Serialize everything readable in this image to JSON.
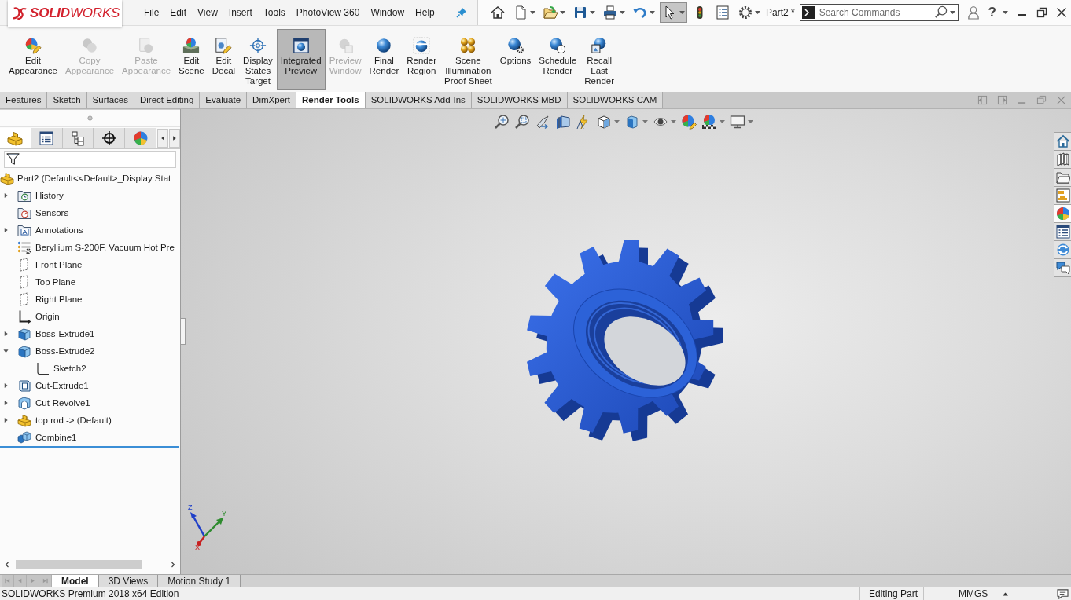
{
  "title_bar": {
    "logo": "**SOLID**WORKS",
    "menu": [
      "File",
      "Edit",
      "View",
      "Insert",
      "Tools",
      "PhotoView 360",
      "Window",
      "Help"
    ],
    "quick_access": [
      {
        "kind": "home",
        "menu": false,
        "pressed": false
      },
      {
        "kind": "new",
        "menu": true,
        "pressed": false
      },
      {
        "kind": "open",
        "menu": true,
        "pressed": false
      },
      {
        "kind": "save",
        "menu": true,
        "pressed": false
      },
      {
        "kind": "print",
        "menu": true,
        "pressed": false
      },
      {
        "kind": "undo",
        "menu": true,
        "pressed": false
      },
      {
        "kind": "select",
        "menu": true,
        "pressed": true
      },
      {
        "kind": "rebuild",
        "menu": false,
        "pressed": false
      },
      {
        "kind": "properties",
        "menu": false,
        "pressed": false
      },
      {
        "kind": "options",
        "menu": true,
        "pressed": false
      }
    ],
    "document_title": "Part2 *",
    "search": {
      "placeholder": "Search Commands"
    },
    "help": "?"
  },
  "ribbon": {
    "buttons": [
      {
        "kind": "appearance",
        "label": "Edit\nAppearance",
        "disabled": false,
        "pressed": false
      },
      {
        "kind": "copy",
        "label": "Copy\nAppearance",
        "disabled": true,
        "pressed": false
      },
      {
        "kind": "paste",
        "label": "Paste\nAppearance",
        "disabled": true,
        "pressed": false
      },
      {
        "kind": "scene",
        "label": "Edit\nScene",
        "disabled": false,
        "pressed": false
      },
      {
        "kind": "decal",
        "label": "Edit\nDecal",
        "disabled": false,
        "pressed": false
      },
      {
        "kind": "target",
        "label": "Display\nStates\nTarget",
        "disabled": false,
        "pressed": false
      },
      {
        "kind": "preview",
        "label": "Integrated\nPreview",
        "disabled": false,
        "pressed": true
      },
      {
        "kind": "preview-window",
        "label": "Preview\nWindow",
        "disabled": true,
        "pressed": false
      },
      {
        "kind": "render",
        "label": "Final\nRender",
        "disabled": false,
        "pressed": false
      },
      {
        "kind": "region",
        "label": "Render\nRegion",
        "disabled": false,
        "pressed": false
      },
      {
        "kind": "proof",
        "label": "Scene\nIllumination\nProof Sheet",
        "disabled": false,
        "pressed": false
      },
      {
        "kind": "options",
        "label": "Options",
        "disabled": false,
        "pressed": false
      },
      {
        "kind": "schedule",
        "label": "Schedule\nRender",
        "disabled": false,
        "pressed": false
      },
      {
        "kind": "recall",
        "label": "Recall\nLast\nRender",
        "disabled": false,
        "pressed": false
      }
    ]
  },
  "command_tabs": [
    {
      "label": "Features",
      "selected": false
    },
    {
      "label": "Sketch",
      "selected": false
    },
    {
      "label": "Surfaces",
      "selected": false
    },
    {
      "label": "Direct Editing",
      "selected": false
    },
    {
      "label": "Evaluate",
      "selected": false
    },
    {
      "label": "DimXpert",
      "selected": false
    },
    {
      "label": "Render Tools",
      "selected": true
    },
    {
      "label": "SOLIDWORKS Add-Ins",
      "selected": false
    },
    {
      "label": "SOLIDWORKS MBD",
      "selected": false
    },
    {
      "label": "SOLIDWORKS CAM",
      "selected": false
    }
  ],
  "feature_manager": {
    "tabs": [
      {
        "kind": "feature",
        "selected": true
      },
      {
        "kind": "property",
        "selected": false
      },
      {
        "kind": "configuration",
        "selected": false
      },
      {
        "kind": "dimxpert",
        "selected": false
      },
      {
        "kind": "display",
        "selected": false
      }
    ],
    "tree": {
      "root": {
        "kind": "part",
        "label": "Part2 (Default<<Default>_Display Stat",
        "children": [
          {
            "kind": "history",
            "label": "History",
            "expandable": true,
            "expanded": false
          },
          {
            "kind": "sensors",
            "label": "Sensors",
            "expandable": false,
            "expanded": false
          },
          {
            "kind": "annotations",
            "label": "Annotations",
            "expandable": true,
            "expanded": false
          },
          {
            "kind": "material",
            "label": "Beryllium S-200F, Vacuum Hot Pre",
            "expandable": false,
            "expanded": false
          },
          {
            "kind": "plane",
            "label": "Front Plane",
            "expandable": false,
            "expanded": false
          },
          {
            "kind": "plane",
            "label": "Top Plane",
            "expandable": false,
            "expanded": false
          },
          {
            "kind": "plane",
            "label": "Right Plane",
            "expandable": false,
            "expanded": false
          },
          {
            "kind": "origin",
            "label": "Origin",
            "expandable": false,
            "expanded": false
          },
          {
            "kind": "extrude",
            "label": "Boss-Extrude1",
            "expandable": true,
            "expanded": false
          },
          {
            "kind": "extrude",
            "label": "Boss-Extrude2",
            "expandable": true,
            "expanded": true,
            "children": [
              {
                "kind": "sketch",
                "label": "Sketch2",
                "expandable": false,
                "expanded": false
              }
            ]
          },
          {
            "kind": "cut-extrude",
            "label": "Cut-Extrude1",
            "expandable": true,
            "expanded": false
          },
          {
            "kind": "cut-revolve",
            "label": "Cut-Revolve1",
            "expandable": true,
            "expanded": false
          },
          {
            "kind": "part",
            "label": "top rod -> (Default)",
            "expandable": true,
            "expanded": false
          },
          {
            "kind": "combine",
            "label": "Combine1",
            "expandable": false,
            "expanded": false
          }
        ]
      }
    }
  },
  "task_pane": [
    {
      "kind": "resources",
      "selected": false
    },
    {
      "kind": "library",
      "selected": false
    },
    {
      "kind": "explorer",
      "selected": false
    },
    {
      "kind": "palette",
      "selected": false
    },
    {
      "kind": "appearances",
      "selected": true
    },
    {
      "kind": "properties",
      "selected": false
    },
    {
      "kind": "sync",
      "selected": false
    },
    {
      "kind": "forum",
      "selected": false
    }
  ],
  "triad": {
    "x": "X",
    "y": "Y",
    "z": "Z"
  },
  "model_tabs": [
    {
      "label": "Model",
      "selected": true
    },
    {
      "label": "3D Views",
      "selected": false
    },
    {
      "label": "Motion Study 1",
      "selected": false
    }
  ],
  "status_bar": {
    "edition": "SOLIDWORKS Premium 2018 x64 Edition",
    "mode": "Editing Part",
    "units": "MMGS"
  }
}
